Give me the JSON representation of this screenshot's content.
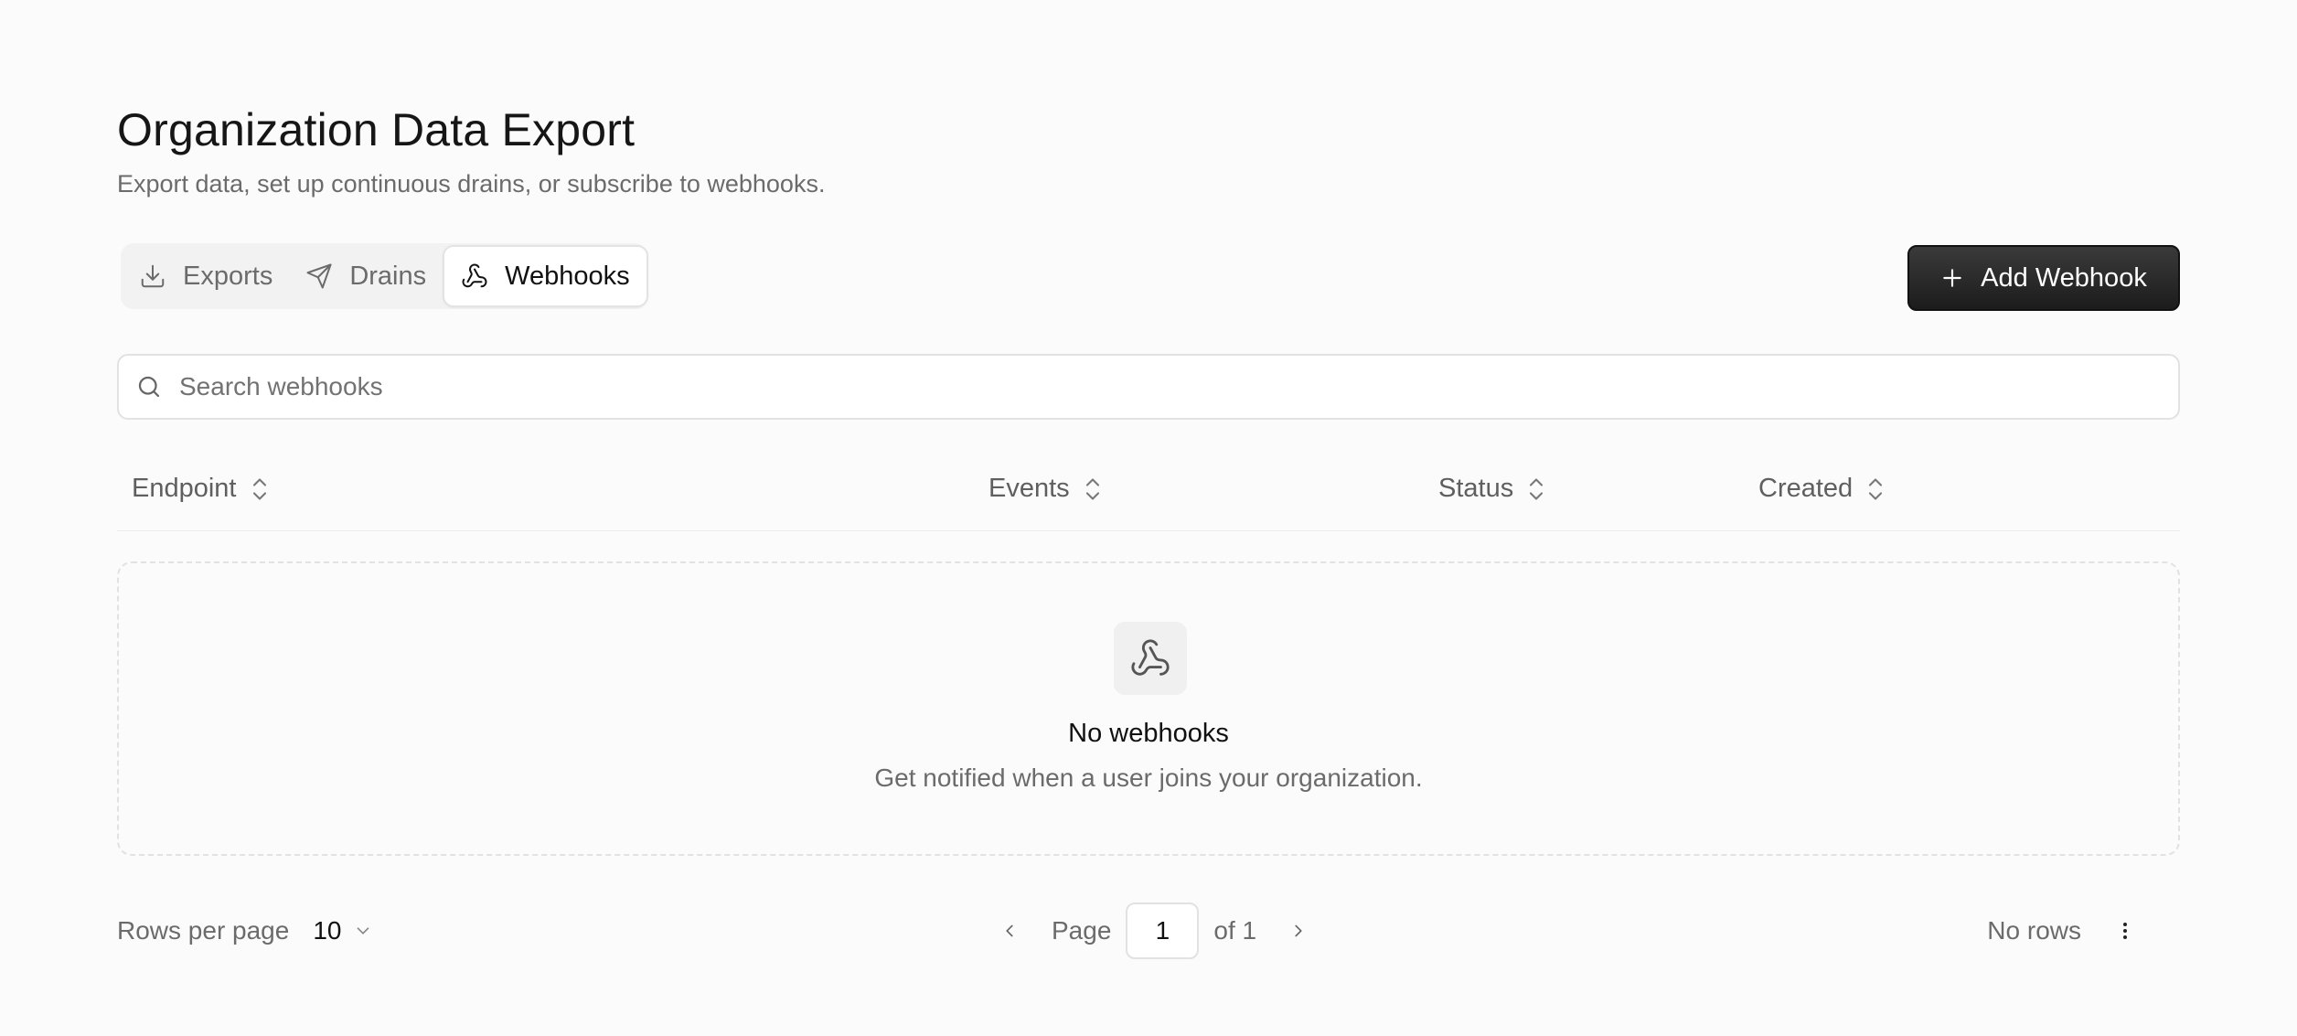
{
  "page": {
    "title": "Organization Data Export",
    "subtitle": "Export data, set up continuous drains, or subscribe to webhooks."
  },
  "tabs": [
    {
      "label": "Exports",
      "icon": "download-icon",
      "active": false
    },
    {
      "label": "Drains",
      "icon": "send-icon",
      "active": false
    },
    {
      "label": "Webhooks",
      "icon": "webhook-icon",
      "active": true
    }
  ],
  "actions": {
    "add_label": "Add Webhook"
  },
  "search": {
    "placeholder": "Search webhooks",
    "value": ""
  },
  "table": {
    "columns": [
      "Endpoint",
      "Events",
      "Status",
      "Created"
    ]
  },
  "empty_state": {
    "icon": "webhook-icon",
    "title": "No webhooks",
    "description": "Get notified when a user joins your organization."
  },
  "pagination": {
    "rows_per_page_label": "Rows per page",
    "rows_per_page_value": "10",
    "page_label": "Page",
    "current_page": "1",
    "of_label": "of 1",
    "status": "No rows"
  },
  "colors": {
    "background": "#fbfbfb",
    "primary_button": "#222222",
    "muted_text": "#6b6b6b"
  }
}
